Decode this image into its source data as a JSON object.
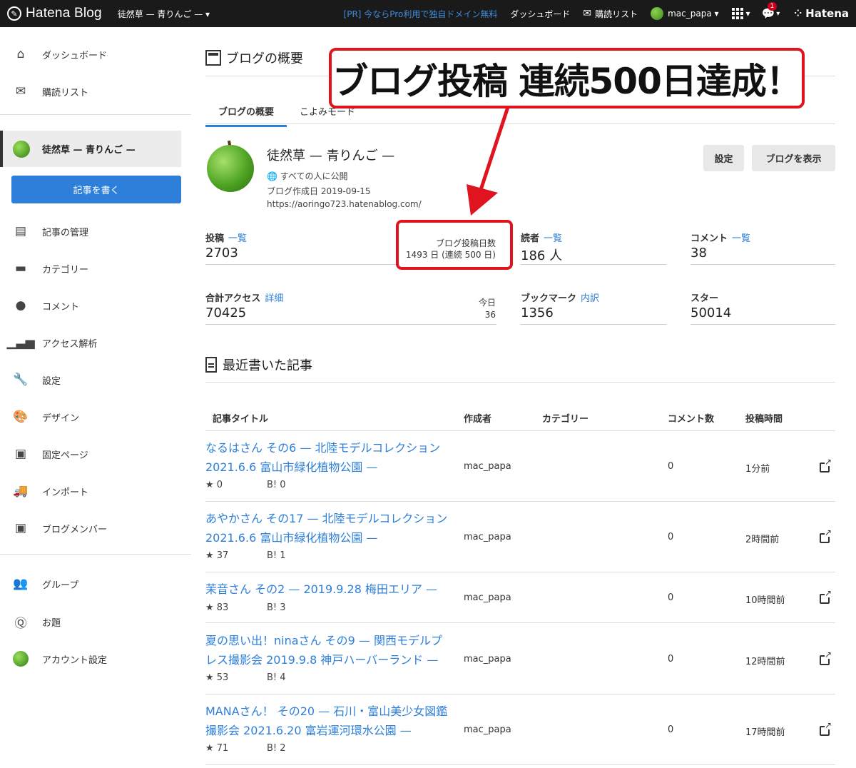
{
  "topbar": {
    "logo": "Hatena Blog",
    "blog_switch": "徒然草 — 青りんご — ▾",
    "pr": "[PR] 今ならPro利用で独自ドメイン無料",
    "dashboard": "ダッシュボード",
    "reading_list": "購読リスト",
    "user": "mac_papa ▾",
    "notif_count": "1",
    "hatena": "Hatena"
  },
  "sidebar": {
    "dashboard": "ダッシュボード",
    "reading_list": "購読リスト",
    "blog": "徒然草 — 青りんご —",
    "write": "記事を書く",
    "items": [
      "記事の管理",
      "カテゴリー",
      "コメント",
      "アクセス解析",
      "設定",
      "デザイン",
      "固定ページ",
      "インポート",
      "ブログメンバー"
    ],
    "bottom": [
      "グループ",
      "お題",
      "アカウント設定"
    ]
  },
  "main": {
    "title": "ブログの概要",
    "tabs": [
      "ブログの概要",
      "こよみモード"
    ],
    "blog_name": "徒然草 — 青りんご —",
    "visibility": "すべての人に公開",
    "created": "ブログ作成日 2019-09-15",
    "url": "https://aoringo723.hatenablog.com/",
    "btn_settings": "設定",
    "btn_view": "ブログを表示",
    "stats": {
      "posts_label": "投稿",
      "posts_link": "一覧",
      "posts_value": "2703",
      "days_label": "ブログ投稿日数",
      "days_value": "1493 日 (連続 500 日)",
      "readers_label": "読者",
      "readers_link": "一覧",
      "readers_value": "186 人",
      "comments_label": "コメント",
      "comments_link": "一覧",
      "comments_value": "38",
      "access_label": "合計アクセス",
      "access_link": "詳細",
      "access_value": "70425",
      "today_label": "今日",
      "today_value": "36",
      "bookmarks_label": "ブックマーク",
      "bookmarks_link": "内訳",
      "bookmarks_value": "1356",
      "stars_label": "スター",
      "stars_value": "50014"
    },
    "recent_title": "最近書いた記事",
    "columns": [
      "記事タイトル",
      "作成者",
      "カテゴリー",
      "コメント数",
      "投稿時間"
    ],
    "articles": [
      {
        "title": "なるはさん その6 — 北陸モデルコレクション 2021.6.6 富山市緑化植物公園 —",
        "stars": "★ 0",
        "bookmarks": "B! 0",
        "author": "mac_papa",
        "comments": "0",
        "time": "1分前"
      },
      {
        "title": "あやかさん その17 — 北陸モデルコレクション 2021.6.6 富山市緑化植物公園 —",
        "stars": "★ 37",
        "bookmarks": "B! 1",
        "author": "mac_papa",
        "comments": "0",
        "time": "2時間前"
      },
      {
        "title": "茉音さん その2 — 2019.9.28 梅田エリア —",
        "stars": "★ 83",
        "bookmarks": "B! 3",
        "author": "mac_papa",
        "comments": "0",
        "time": "10時間前"
      },
      {
        "title": "夏の思い出！ninaさん その9 — 関西モデルプレス撮影会 2019.9.8 神戸ハーバーランド —",
        "stars": "★ 53",
        "bookmarks": "B! 4",
        "author": "mac_papa",
        "comments": "0",
        "time": "12時間前"
      },
      {
        "title": "MANAさん！ その20 — 石川・富山美少女図鑑 撮影会 2021.6.20 富岩運河環水公園 —",
        "stars": "★ 71",
        "bookmarks": "B! 2",
        "author": "mac_papa",
        "comments": "0",
        "time": "17時間前"
      }
    ]
  },
  "annotation": {
    "callout": "ブログ投稿 連続500日達成！"
  },
  "colors": {
    "accent": "#2d7fd9",
    "annotation": "#e0141e",
    "topbar": "#1a1a1a"
  }
}
